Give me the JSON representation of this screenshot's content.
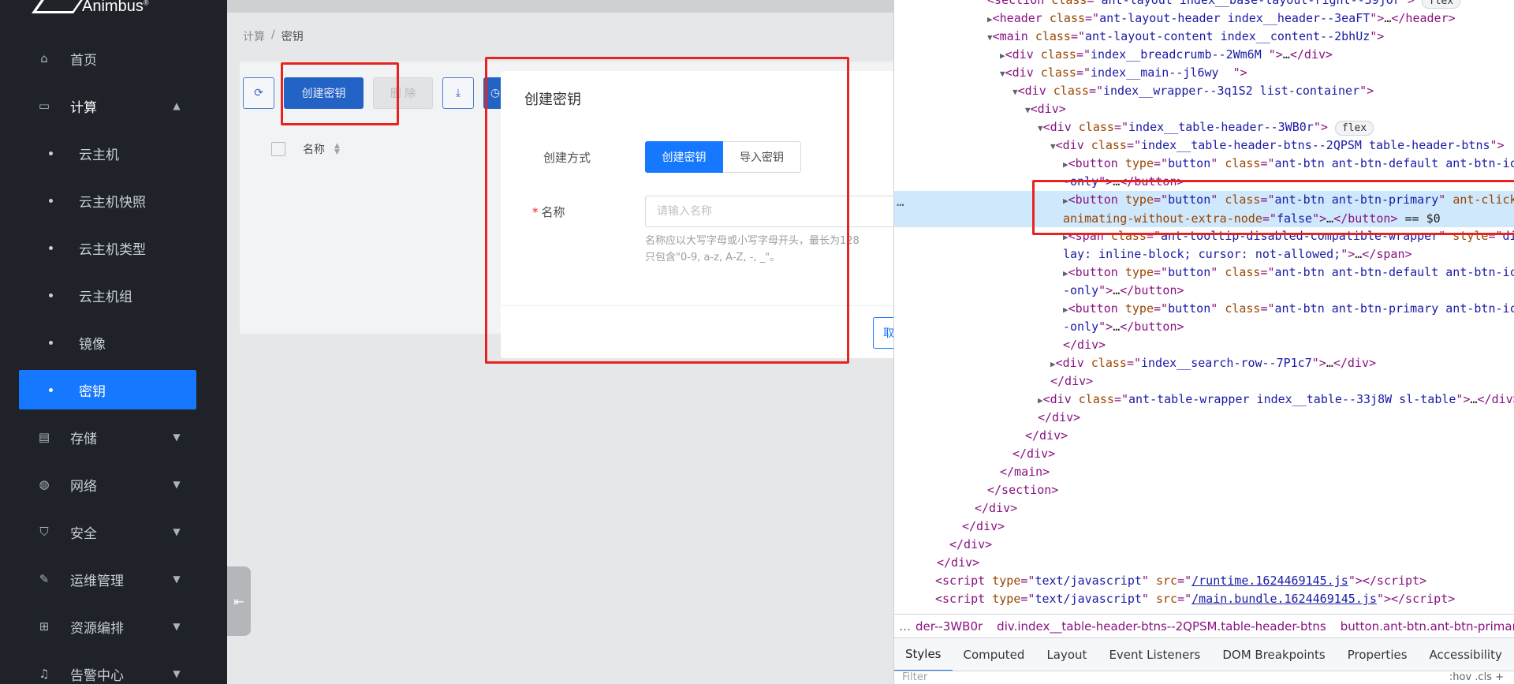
{
  "app": {
    "brand": "Animbus",
    "brand_mark": "®"
  },
  "sidebar": {
    "home": "首页",
    "compute": "计算",
    "compute_children": [
      "云主机",
      "云主机快照",
      "云主机类型",
      "云主机组",
      "镜像",
      "密钥"
    ],
    "storage": "存储",
    "network": "网络",
    "security": "安全",
    "ops": "运维管理",
    "orchestration": "资源编排",
    "alerts": "告警中心"
  },
  "breadcrumb": {
    "parent": "计算",
    "separator": "/",
    "current": "密钥"
  },
  "toolbar": {
    "create_label": "创建密钥",
    "delete_label": "删 除"
  },
  "table": {
    "col_name": "名称"
  },
  "modal": {
    "title": "创建密钥",
    "method_label": "创建方式",
    "method_options": [
      "创建密钥",
      "导入密钥"
    ],
    "name_label": "名称",
    "required_mark": "*",
    "name_placeholder": "请输入名称",
    "help_line1": "名称应以大写字母或小写字母开头，最长为128",
    "help_line2": "只包含\"0-9, a-z, A-Z, -, _\"。",
    "footer_btn_partial": "取"
  },
  "devtools": {
    "flex_badge": "flex",
    "breadcrumbs": [
      "…",
      "der--3WB0r",
      "div.index__table-header-btns--2QPSM.table-header-btns",
      "button.ant-btn.ant-btn-primar"
    ],
    "tabs": [
      "Styles",
      "Computed",
      "Layout",
      "Event Listeners",
      "DOM Breakpoints",
      "Properties",
      "Accessibility"
    ],
    "active_tab": "Styles",
    "filter_placeholder": "Filter",
    "filter_right": ":hov  .cls  +",
    "runtime_src": "/runtime.1624469145.js",
    "main_src": "/main.bundle.1624469145.js"
  },
  "colors": {
    "primary": "#1677ff",
    "sidebar_bg": "#1f2329",
    "highlight": "#e8231f",
    "selected_row": "#cfe8fc"
  }
}
